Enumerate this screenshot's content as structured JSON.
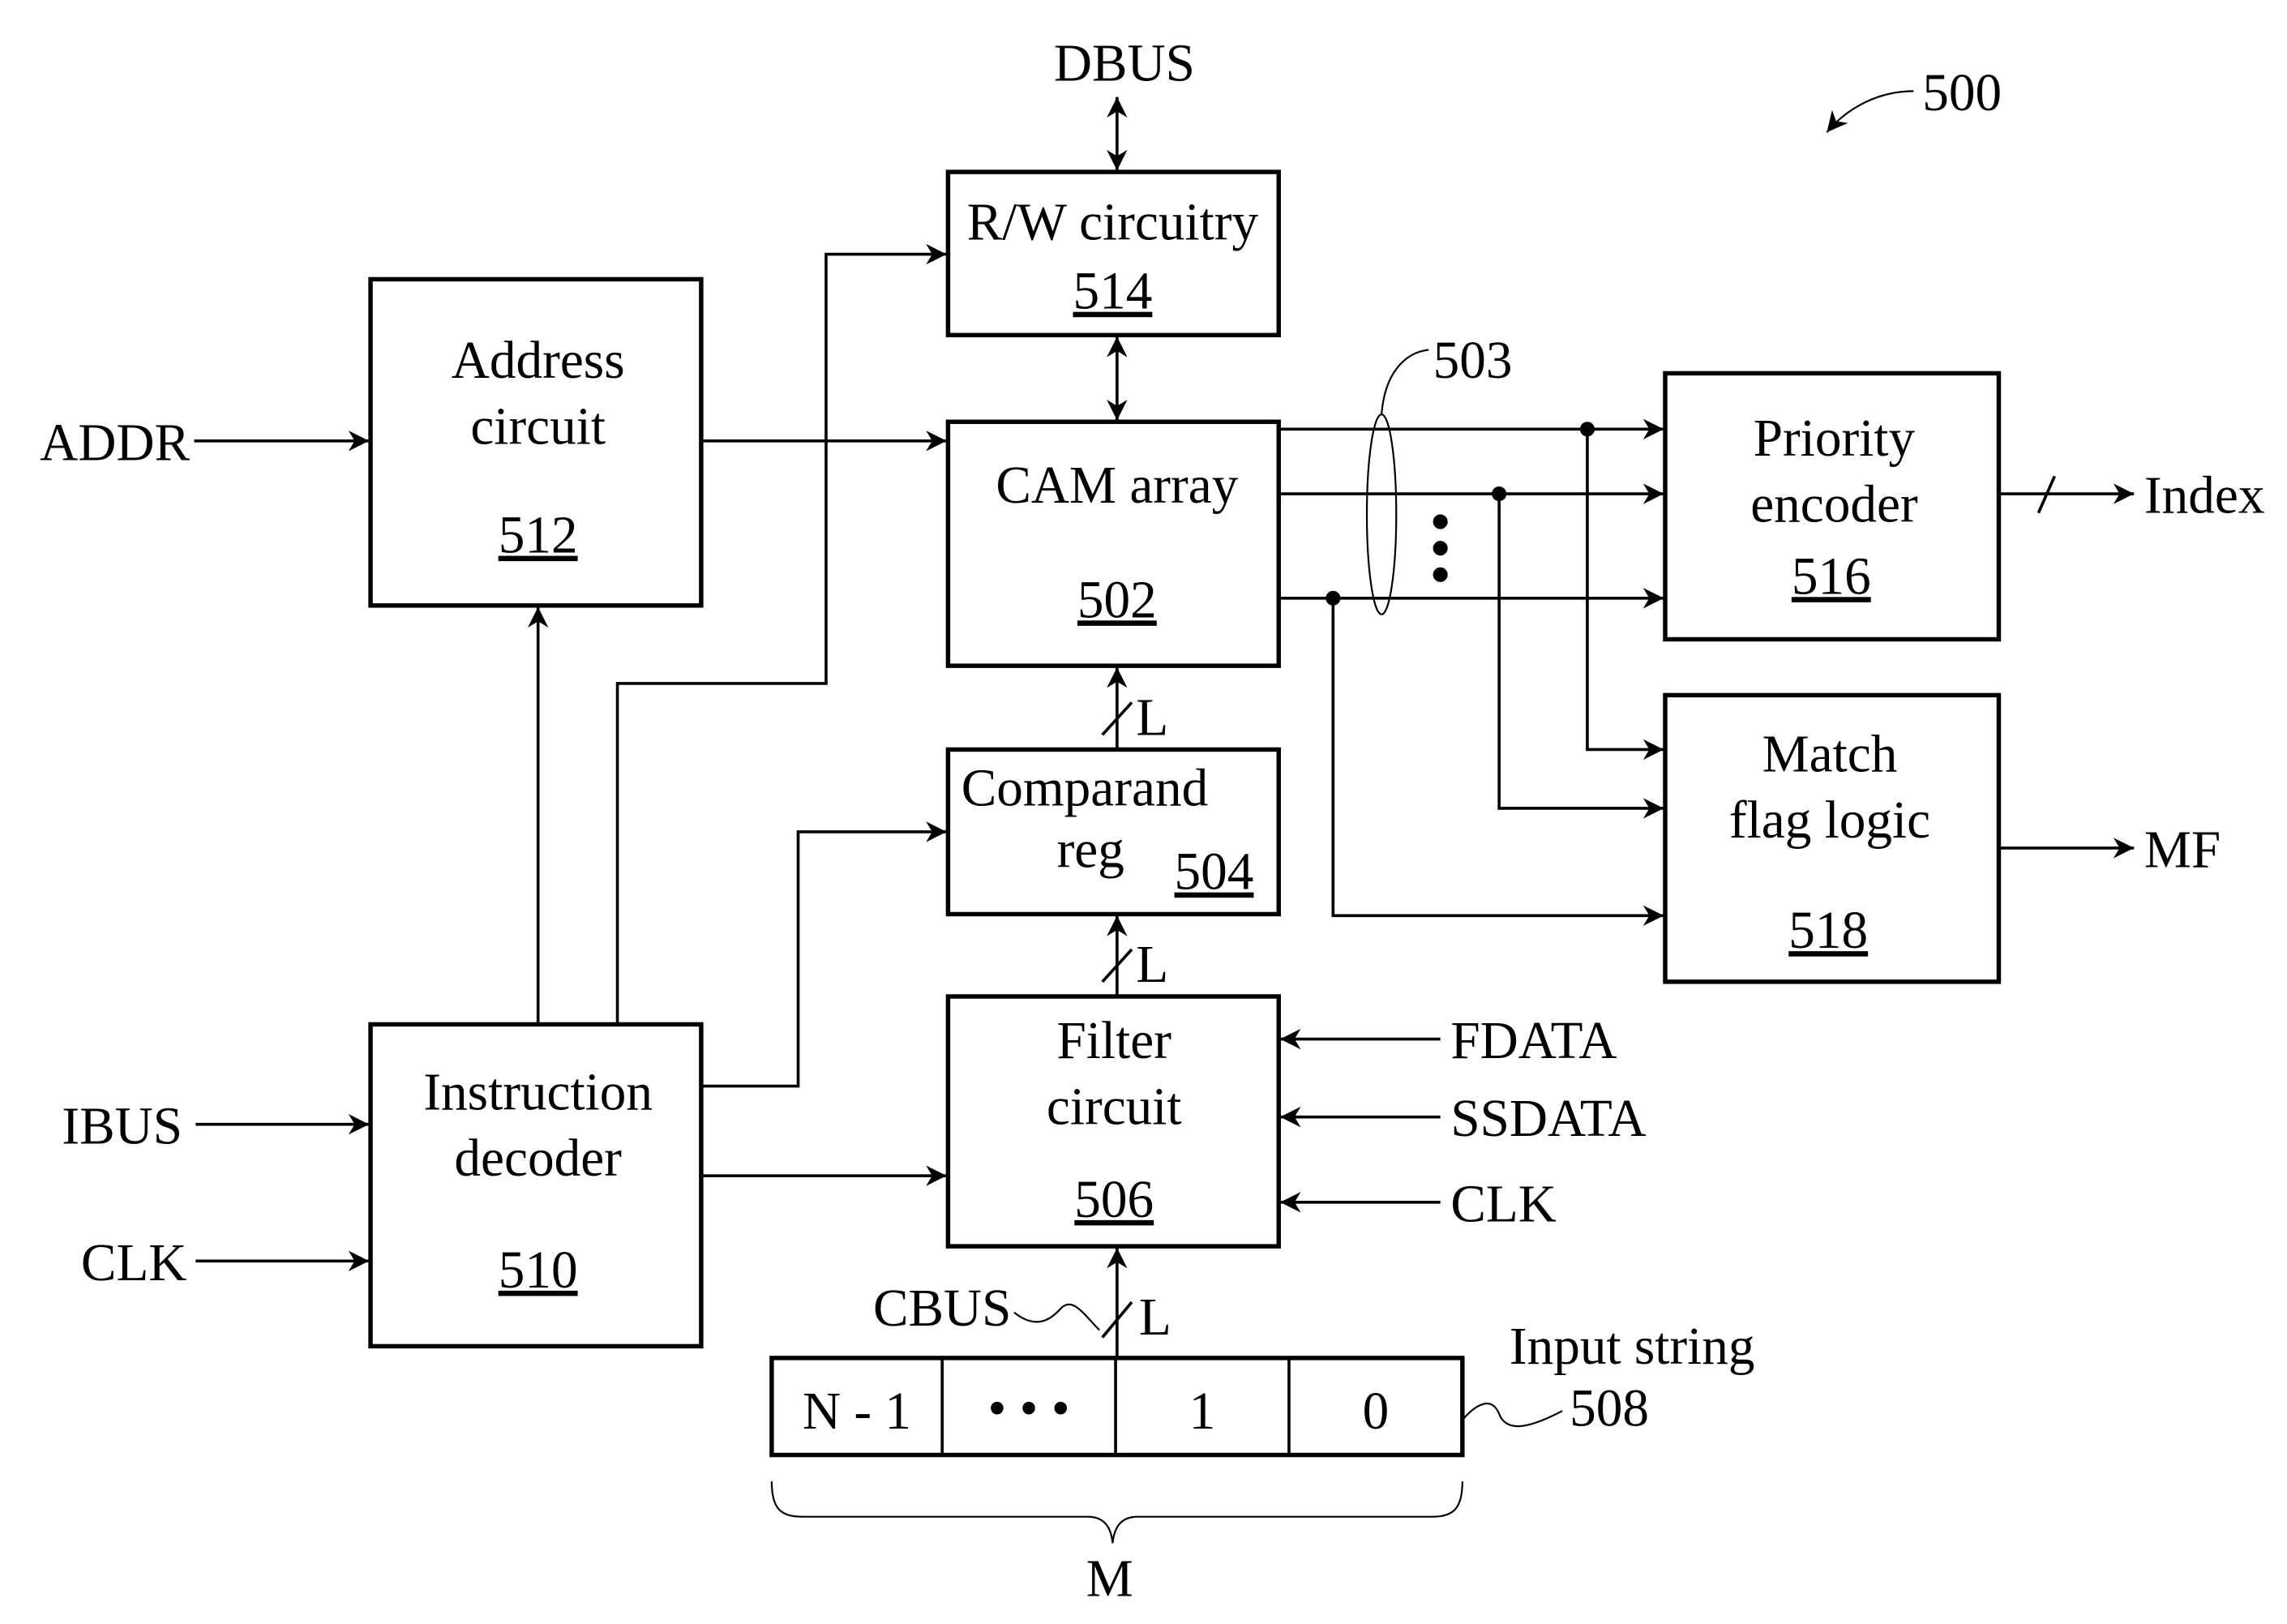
{
  "figure": {
    "reference": "500",
    "bus_ellipse_ref": "503"
  },
  "blocks": {
    "rw": {
      "line1": "R/W circuitry",
      "ref": "514"
    },
    "cam": {
      "line1": "CAM array",
      "ref": "502"
    },
    "address": {
      "line1": "Address",
      "line2": "circuit",
      "ref": "512"
    },
    "comparand": {
      "line1": "Comparand",
      "line2": "reg",
      "ref": "504"
    },
    "filter": {
      "line1": "Filter",
      "line2": "circuit",
      "ref": "506"
    },
    "decoder": {
      "line1": "Instruction",
      "line2": "decoder",
      "ref": "510"
    },
    "priority": {
      "line1": "Priority",
      "line2": "encoder",
      "ref": "516"
    },
    "matchflag": {
      "line1": "Match",
      "line2": "flag logic",
      "ref": "518"
    }
  },
  "signals": {
    "dbus": "DBUS",
    "addr": "ADDR",
    "ibus": "IBUS",
    "clk_decoder": "CLK",
    "fdata": "FDATA",
    "ssdata": "SSDATA",
    "clk_filter": "CLK",
    "cbus": "CBUS",
    "index": "Index",
    "mf": "MF",
    "width_comparand_to_cam": "L",
    "width_filter_to_comparand": "L",
    "width_cbus": "L"
  },
  "input_string": {
    "label": "Input string",
    "ref": "508",
    "cells": [
      "N - 1",
      "• • •",
      "1",
      "0"
    ],
    "span_label": "M"
  }
}
